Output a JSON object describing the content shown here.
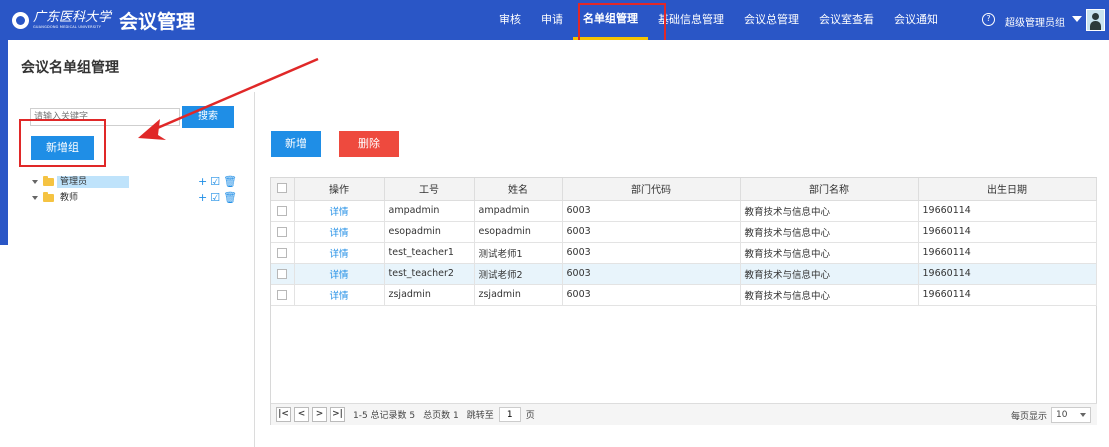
{
  "header": {
    "logo_cn": "广东医科大学",
    "logo_en": "GUANGDONG MEDICAL UNIVERSITY",
    "app_title": "会议管理",
    "nav": [
      "审核",
      "申请",
      "名单组管理",
      "基础信息管理",
      "会议总管理",
      "会议室查看",
      "会议通知"
    ],
    "active_nav": "名单组管理",
    "help_symbol": "?",
    "user_role": "超级管理员组"
  },
  "page": {
    "title": "会议名单组管理"
  },
  "sidebar": {
    "search_placeholder": "请输入关键字",
    "search_button": "搜索",
    "add_group_button": "新增组",
    "tree": [
      {
        "label": "管理员",
        "selected": true
      },
      {
        "label": "教师",
        "selected": false
      }
    ],
    "tree_action_icons": [
      "plus-icon",
      "edit-icon",
      "trash-icon"
    ]
  },
  "toolbar": {
    "new_button": "新增",
    "delete_button": "删除"
  },
  "table": {
    "columns": [
      "操作",
      "工号",
      "姓名",
      "部门代码",
      "部门名称",
      "出生日期"
    ],
    "rows": [
      {
        "op": "详情",
        "id": "ampadmin",
        "name": "ampadmin",
        "dept_code": "6003",
        "dept_name": "教育技术与信息中心",
        "birth": "19660114"
      },
      {
        "op": "详情",
        "id": "esopadmin",
        "name": "esopadmin",
        "dept_code": "6003",
        "dept_name": "教育技术与信息中心",
        "birth": "19660114"
      },
      {
        "op": "详情",
        "id": "test_teacher1",
        "name": "测试老师1",
        "dept_code": "6003",
        "dept_name": "教育技术与信息中心",
        "birth": "19660114"
      },
      {
        "op": "详情",
        "id": "test_teacher2",
        "name": "测试老师2",
        "dept_code": "6003",
        "dept_name": "教育技术与信息中心",
        "birth": "19660114"
      },
      {
        "op": "详情",
        "id": "zsjadmin",
        "name": "zsjadmin",
        "dept_code": "6003",
        "dept_name": "教育技术与信息中心",
        "birth": "19660114"
      }
    ]
  },
  "pager": {
    "first": "|<",
    "prev": "<",
    "next": ">",
    "last": ">|",
    "range": "1-5 总记录数 5",
    "total_pages": "总页数 1",
    "jump_label": "跳转至",
    "page_value": "1",
    "page_unit": "页",
    "page_size_label": "每页显示",
    "page_size": "10"
  },
  "annotation_color": "#e02828",
  "accent_color": "#1f8ee6"
}
